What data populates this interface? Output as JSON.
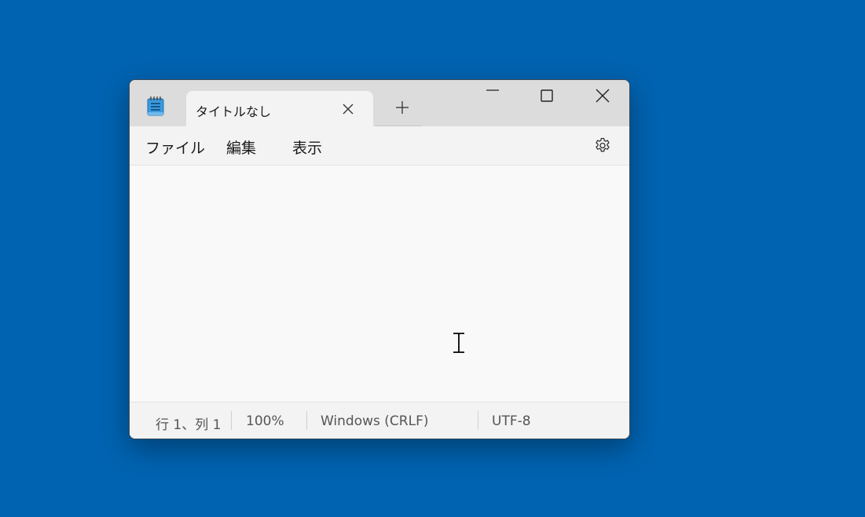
{
  "window": {
    "tab_title": "タイトルなし"
  },
  "menu": {
    "file": "ファイル",
    "edit": "編集",
    "view": "表示"
  },
  "status": {
    "position": "行 1、列 1",
    "zoom": "100%",
    "line_ending": "Windows (CRLF)",
    "encoding": "UTF-8"
  },
  "icons": {
    "app": "notepad-icon",
    "tab_close": "close-icon",
    "new_tab": "plus-icon",
    "minimize": "minimize-icon",
    "maximize": "maximize-icon",
    "close": "close-icon",
    "settings": "gear-icon",
    "cursor": "text-cursor-icon"
  },
  "colors": {
    "desktop": "#0063b1",
    "titlebar": "#dcdcdc",
    "tab": "#f3f3f3",
    "editor": "#f9f9f9",
    "app_icon_accent": "#2a8fd6"
  }
}
